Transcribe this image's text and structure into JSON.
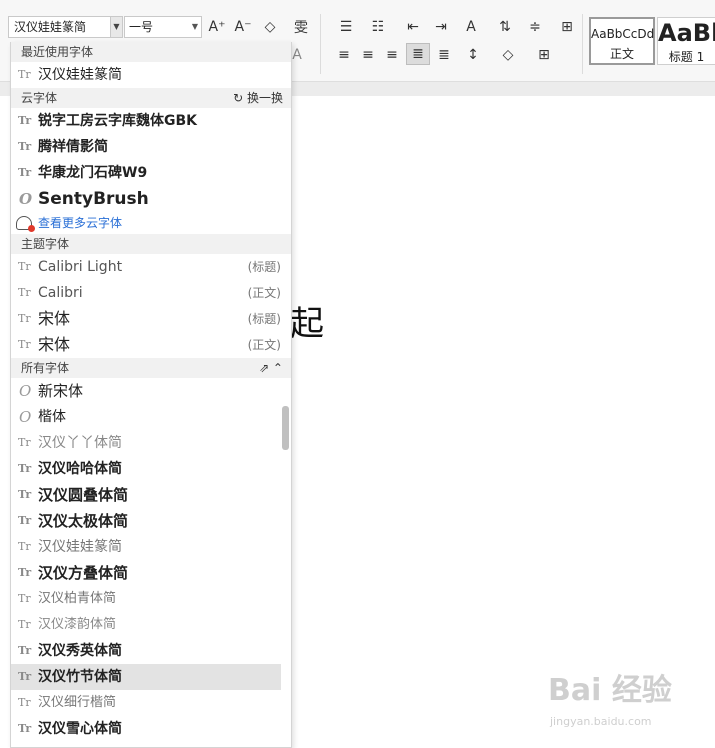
{
  "toolbar": {
    "font_name": "汉仪娃娃篆简",
    "font_size": "一号",
    "grow_font_icon": "A⁺",
    "shrink_font_icon": "A⁻",
    "clear_format_icon": "◇",
    "phonetic_icon": "雯",
    "char_border_icon": "A"
  },
  "styles": [
    {
      "sample": "AaBbCcDd",
      "name": "正文"
    },
    {
      "sample": "AaBb",
      "name": "标题 1"
    }
  ],
  "dropdown": {
    "recent_header": "最近使用字体",
    "recent": [
      "汉仪娃娃篆简"
    ],
    "cloud_header": "云字体",
    "cloud_refresh": "换一换",
    "cloud": [
      "锐字工房云字库魏体GBK",
      "腾祥倩影简",
      "华康龙门石碑W9",
      "SentyBrush"
    ],
    "more_cloud": "查看更多云字体",
    "theme_header": "主题字体",
    "theme": [
      {
        "name": "Calibri Light",
        "tag": "(标题)"
      },
      {
        "name": "Calibri",
        "tag": "(正文)"
      },
      {
        "name": "宋体",
        "tag": "(标题)"
      },
      {
        "name": "宋体",
        "tag": "(正文)"
      }
    ],
    "all_header": "所有字体",
    "all": [
      "新宋体",
      "楷体",
      "汉仪丫丫体简",
      "汉仪哈哈体简",
      "汉仪圆叠体简",
      "汉仪太极体简",
      "汉仪娃娃篆简",
      "汉仪方叠体简",
      "汉仪柏青体简",
      "汉仪漆韵体简",
      "汉仪秀英体简",
      "汉仪竹节体简",
      "汉仪细行楷简",
      "汉仪雪心体简"
    ],
    "highlighted": "汉仪竹节体简"
  },
  "document": {
    "visible_char": "起"
  },
  "watermark": {
    "brand": "Bai 经验",
    "url": "jingyan.baidu.com"
  }
}
